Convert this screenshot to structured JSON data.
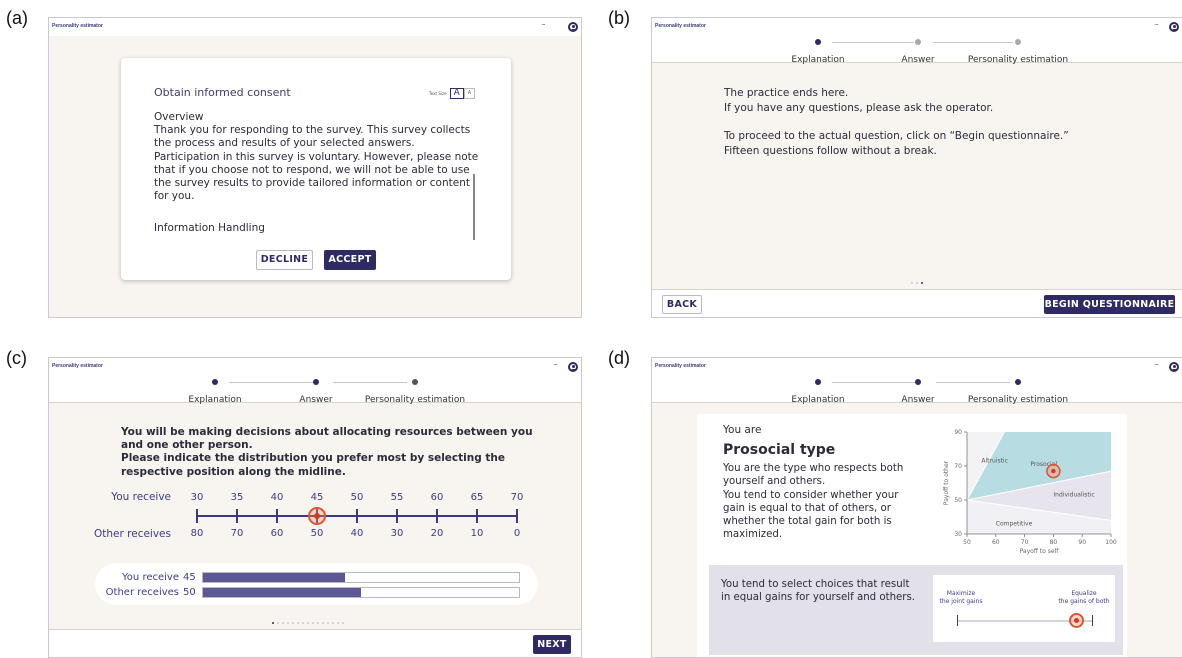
{
  "panel_labels": {
    "a": "(a)",
    "b": "(b)",
    "c": "(c)",
    "d": "(d)"
  },
  "app": {
    "title": "Personality estimator",
    "menu_glyph": "···"
  },
  "steps": {
    "explanation": "Explanation",
    "answer": "Answer",
    "estimation": "Personality estimation"
  },
  "colors": {
    "accent": "#2e2a63",
    "background": "#f8f4f0",
    "marker": "#d8381c",
    "bar": "#5b5895"
  },
  "consent": {
    "title": "Obtain informed consent",
    "text_size_label": "Text Size",
    "text_size_large": "A",
    "text_size_small": "A",
    "overview_heading": "Overview",
    "body": [
      "Thank you for responding to the survey. This survey collects",
      "the process and results of your selected answers.",
      "Participation in this survey is voluntary. However, please note",
      "that if you choose not to respond, we will not be able to use",
      "the survey results to provide tailored information or content",
      "for you."
    ],
    "info_heading": "Information Handling",
    "decline": "DECLINE",
    "accept": "ACCEPT"
  },
  "practice_end": {
    "lines": [
      "The practice ends here.",
      "If you have any questions, please ask the operator.",
      "",
      "To proceed to the actual question, click on “Begin questionnaire.”",
      "Fifteen questions follow without a break."
    ],
    "back": "BACK",
    "begin": "BEGIN QUESTIONNAIRE"
  },
  "allocation": {
    "instruction": [
      "You will be making decisions about allocating resources between you",
      "and one other person.",
      "Please indicate the distribution you prefer most by selecting the",
      "respective position along the midline."
    ],
    "you_receive_label": "You receive",
    "other_receives_label": "Other receives",
    "you_values": [
      "30",
      "35",
      "40",
      "45",
      "50",
      "55",
      "60",
      "65",
      "70"
    ],
    "other_values": [
      "80",
      "70",
      "60",
      "50",
      "40",
      "30",
      "20",
      "10",
      "0"
    ],
    "selected_index": 3,
    "summary": [
      {
        "label": "You receive",
        "value": "45",
        "fraction": 0.45
      },
      {
        "label": "Other receives",
        "value": "50",
        "fraction": 0.5
      }
    ],
    "next": "NEXT",
    "page_total": 15,
    "page_current": 1
  },
  "result": {
    "you_are": "You are",
    "type": "Prosocial type",
    "description": [
      "You are the type who respects both",
      "yourself and others.",
      "You tend to consider whether your",
      "gain is equal to that of others, or",
      "whether the total gain for both is",
      "maximized."
    ],
    "chart_data": {
      "type": "scatter",
      "xlabel": "Payoff to self",
      "ylabel": "Payoff to other",
      "x_ticks": [
        "50",
        "60",
        "70",
        "80",
        "90",
        "100"
      ],
      "y_ticks": [
        "30",
        "50",
        "70",
        "90"
      ],
      "xlim": [
        50,
        100
      ],
      "ylim": [
        30,
        90
      ],
      "regions": [
        "Altruistic",
        "Prosocial",
        "Individualistic",
        "Competitive"
      ],
      "highlighted_region": "Prosocial",
      "point": {
        "x": 80,
        "y": 67
      }
    },
    "tendency": [
      "You tend to select choices that result",
      "in equal gains for yourself and others."
    ],
    "slider": {
      "left_label": [
        "Maximize",
        "the joint gains"
      ],
      "right_label": [
        "Equalize",
        "the gains of both"
      ],
      "position": 0.88
    }
  }
}
